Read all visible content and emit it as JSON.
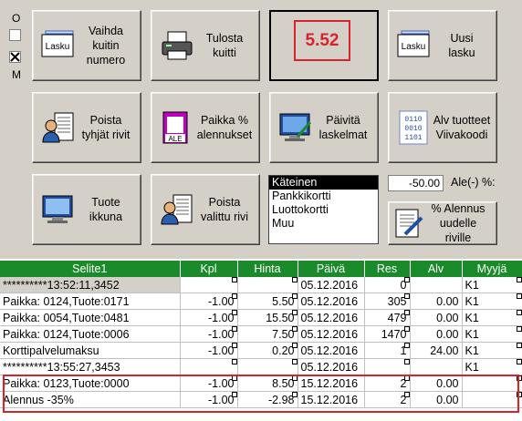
{
  "side": {
    "o_label": "O",
    "m_label": "M"
  },
  "buttons": {
    "change_receipt": "Vaihda\nkuitin\nnumero",
    "print_receipt": "Tulosta\nkuitti",
    "new_invoice": "Uusi\nlasku",
    "delete_empty_rows": "Poista\ntyhjät rivit",
    "place_discounts": "Paikka %\nalennukset",
    "update_calculations": "Päivitä\nlaskelmat",
    "vat_products_barcode": "Alv tuotteet\nViivakoodi",
    "product_window": "Tuote\nikkuna",
    "delete_selected_row": "Poista\nvalittu rivi",
    "discount_new_row": "% Alennus\nuudelle riville"
  },
  "icons": {
    "invoice_text": "Lasku",
    "sale_text": "ALE",
    "binary_text": "0110\n0010\n1101"
  },
  "total": {
    "value": "5.52",
    "color": "#d9232a"
  },
  "payment_methods": [
    "Käteinen",
    "Pankkikortti",
    "Luottokortti",
    "Muu"
  ],
  "discount": {
    "value": "-50.00",
    "label": "Ale(-) %:"
  },
  "table": {
    "columns": [
      "Selite1",
      "Kpl",
      "Hinta",
      "Päivä",
      "Res",
      "Alv",
      "Myyjä"
    ],
    "rows": [
      [
        "**********13:52:11,3452",
        "",
        "",
        "05.12.2016",
        "0",
        "",
        "K1"
      ],
      [
        "Paikka: 0124,Tuote:0171",
        "-1.00",
        "5.50",
        "05.12.2016",
        "305",
        "0.00",
        "K1"
      ],
      [
        "Paikka: 0054,Tuote:0481",
        "-1.00",
        "15.50",
        "05.12.2016",
        "479",
        "0.00",
        "K1"
      ],
      [
        "Paikka: 0124,Tuote:0006",
        "-1.00",
        "7.50",
        "05.12.2016",
        "1470",
        "0.00",
        "K1"
      ],
      [
        "Korttipalvelumaksu",
        "-1.00",
        "0.20",
        "05.12.2016",
        "1",
        "24.00",
        "K1"
      ],
      [
        "**********13:55:27,3453",
        "",
        "",
        "05.12.2016",
        "",
        "",
        "K1"
      ],
      [
        "Paikka: 0123,Tuote:0000",
        "-1.00",
        "8.50",
        "15.12.2016",
        "2",
        "0.00",
        ""
      ],
      [
        "Alennus -35%",
        "-1.00",
        "-2.98",
        "15.12.2016",
        "2",
        "0.00",
        ""
      ]
    ]
  }
}
